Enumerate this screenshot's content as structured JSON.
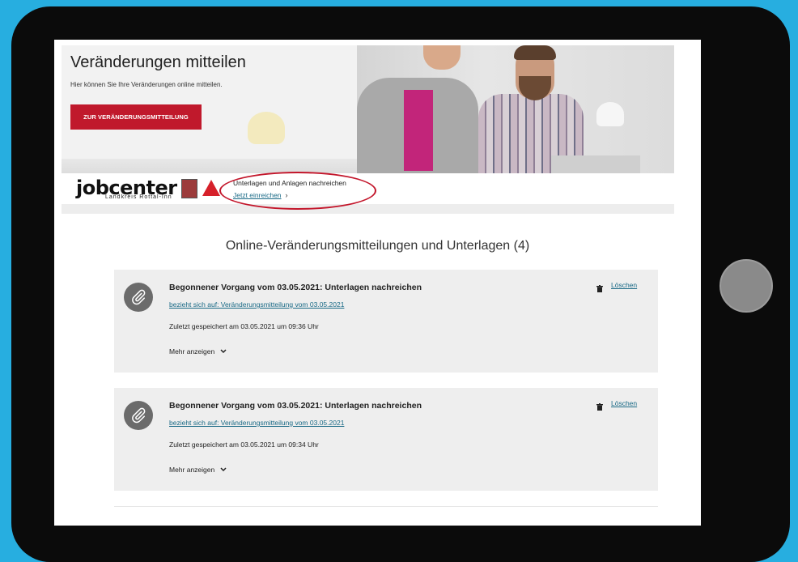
{
  "hero": {
    "title": "Veränderungen mitteilen",
    "subtitle": "Hier können Sie Ihre Veränderungen online mitteilen.",
    "cta_label": "ZUR VERÄNDERUNGSMITTEILUNG"
  },
  "logo": {
    "name": "jobcenter",
    "region": "Landkreis Rottal-Inn"
  },
  "upload": {
    "title": "Unterlagen und Anlagen nachreichen",
    "link": "Jetzt einreichen",
    "chevron": "›"
  },
  "section": {
    "title": "Online-Veränderungsmitteilungen und Unterlagen (4)"
  },
  "cards": [
    {
      "title": "Begonnener Vorgang vom 03.05.2021: Unterlagen nachreichen",
      "reference": "bezieht sich auf: Veränderungsmitteilung vom 03.05.2021",
      "saved": "Zuletzt gespeichert am 03.05.2021 um 09:36 Uhr",
      "more": "Mehr anzeigen",
      "delete": "Löschen"
    },
    {
      "title": "Begonnener Vorgang vom 03.05.2021: Unterlagen nachreichen",
      "reference": "bezieht sich auf: Veränderungsmitteilung vom 03.05.2021",
      "saved": "Zuletzt gespeichert am 03.05.2021 um 09:34 Uhr",
      "more": "Mehr anzeigen",
      "delete": "Löschen"
    }
  ],
  "icons": {
    "attachment": "paperclip-icon",
    "delete": "trash-icon",
    "expand": "chevron-down-icon"
  },
  "colors": {
    "brand_red": "#c0192c",
    "link": "#1a6a86",
    "card_bg": "#eeeeee",
    "page_bg": "#27aee0"
  }
}
